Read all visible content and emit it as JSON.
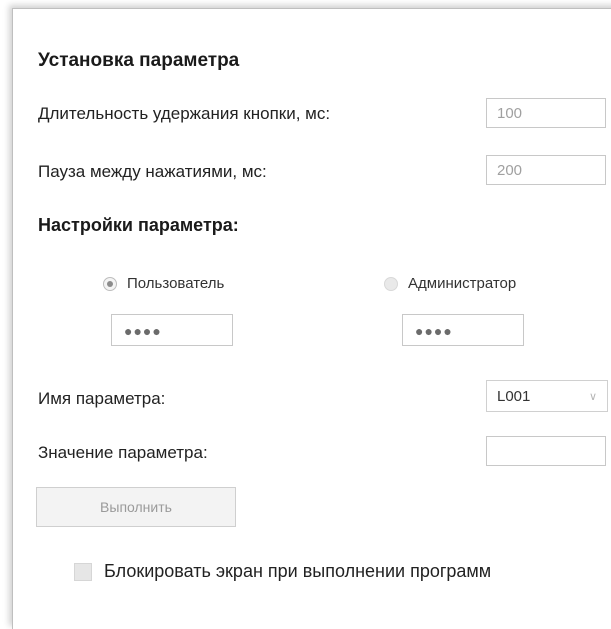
{
  "title": "Установка параметра",
  "hold_duration": {
    "label": "Длительность удержания кнопки, мс:",
    "value": "100"
  },
  "pause": {
    "label": "Пауза между нажатиями, мс:",
    "value": "200"
  },
  "settings_title": "Настройки параметра:",
  "roles": {
    "user": {
      "label": "Пользователь",
      "selected": true,
      "password_mask": "●●●●"
    },
    "admin": {
      "label": "Администратор",
      "selected": false,
      "password_mask": "●●●●"
    }
  },
  "param_name": {
    "label": "Имя параметра:",
    "selected": "L001",
    "icon": "chevron-down-icon"
  },
  "param_value": {
    "label": "Значение параметра:",
    "value": ""
  },
  "execute_button": "Выполнить",
  "lock_screen": {
    "label": "Блокировать экран при выполнении программ",
    "checked": false
  }
}
